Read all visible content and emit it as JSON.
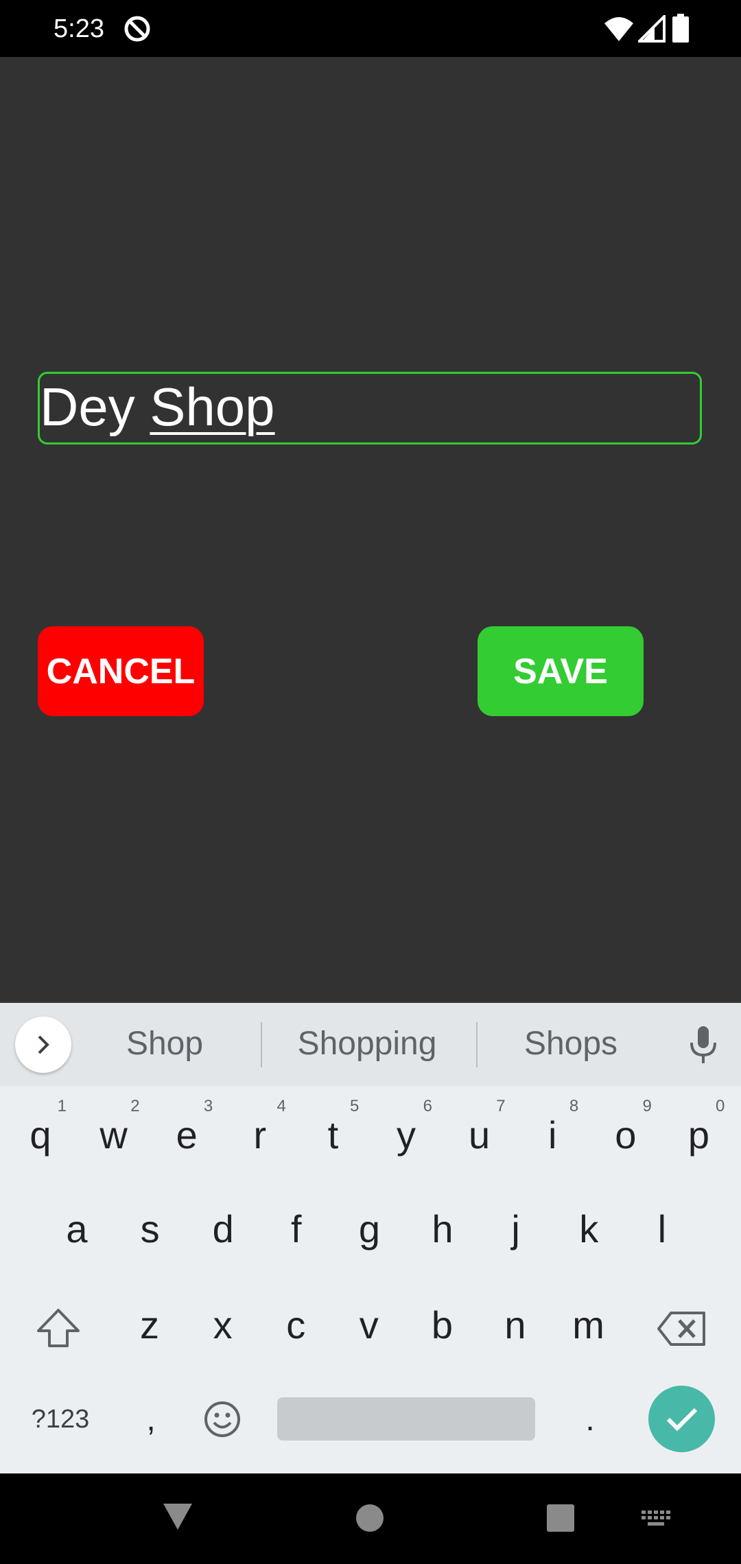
{
  "status_bar": {
    "time": "5:23",
    "icons": [
      "do-not-disturb-icon",
      "wifi-icon",
      "signal-icon",
      "battery-icon"
    ]
  },
  "form": {
    "text_field": {
      "value_plain": "Dey ",
      "value_composing": "Shop",
      "border_color": "#33cc33"
    },
    "cancel_label": "CANCEL",
    "save_label": "SAVE"
  },
  "colors": {
    "background": "#323232",
    "cancel": "#ff0000",
    "save": "#33cc33",
    "keyboard_enter": "#48b9a8"
  },
  "keyboard": {
    "suggestions": [
      "Shop",
      "Shopping",
      "Shops"
    ],
    "row1": [
      {
        "k": "q",
        "h": "1"
      },
      {
        "k": "w",
        "h": "2"
      },
      {
        "k": "e",
        "h": "3"
      },
      {
        "k": "r",
        "h": "4"
      },
      {
        "k": "t",
        "h": "5"
      },
      {
        "k": "y",
        "h": "6"
      },
      {
        "k": "u",
        "h": "7"
      },
      {
        "k": "i",
        "h": "8"
      },
      {
        "k": "o",
        "h": "9"
      },
      {
        "k": "p",
        "h": "0"
      }
    ],
    "row2": [
      "a",
      "s",
      "d",
      "f",
      "g",
      "h",
      "j",
      "k",
      "l"
    ],
    "row3": [
      "z",
      "x",
      "c",
      "v",
      "b",
      "n",
      "m"
    ],
    "symbols_label": "?123",
    "comma": ",",
    "period": "."
  }
}
